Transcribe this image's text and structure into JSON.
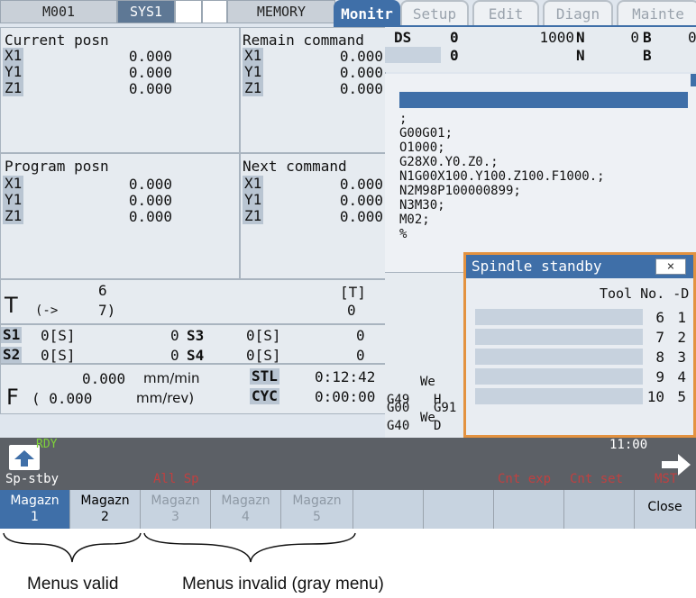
{
  "topbar": {
    "m001": "M001",
    "sys1": "SYS1",
    "memory": "MEMORY"
  },
  "tabs": [
    "Monitr",
    "Setup",
    "Edit",
    "Diagn",
    "Mainte"
  ],
  "current_posn": {
    "title": "Current posn",
    "rows": [
      {
        "axis": "X1",
        "val": "0.000"
      },
      {
        "axis": "Y1",
        "val": "0.000"
      },
      {
        "axis": "Z1",
        "val": "0.000"
      }
    ]
  },
  "remain_command": {
    "title": "Remain command",
    "rows": [
      {
        "axis": "X1",
        "val": "0.000"
      },
      {
        "axis": "Y1",
        "val": "0.000"
      },
      {
        "axis": "Z1",
        "val": "0.000"
      }
    ]
  },
  "program_posn": {
    "title": "Program posn",
    "rows": [
      {
        "axis": "X1",
        "val": "0.000"
      },
      {
        "axis": "Y1",
        "val": "0.000"
      },
      {
        "axis": "Z1",
        "val": "0.000"
      }
    ]
  },
  "next_command": {
    "title": "Next command",
    "rows": [
      {
        "axis": "X1",
        "val": "0.000"
      },
      {
        "axis": "Y1",
        "val": "0.000"
      },
      {
        "axis": "Z1",
        "val": "0.000"
      }
    ]
  },
  "ds": {
    "label": "DS",
    "v1": "0",
    "v2": "1000",
    "n1": "N",
    "n2": "0",
    "b": "B",
    "b0": "0",
    "v3": "0",
    "n3": "N",
    "b2": "B"
  },
  "program": [
    ";",
    "G00G01;",
    "O1000;",
    "G28X0.Y0.Z0.;",
    "N1G00X100.Y100.Z100.F1000.;",
    "N2M98P100000899;",
    "N3M30;",
    "M02;",
    "%"
  ],
  "tool": {
    "T": "T",
    "top": "6",
    "arrow": "(->",
    "next": "7)",
    "bracket": "[T]",
    "tval": "0"
  },
  "spindle": [
    {
      "s": "S1",
      "v": "0[S]",
      "x": "0",
      "s2": "S3",
      "v2": "0[S]",
      "x2": "0"
    },
    {
      "s": "S2",
      "v": "0[S]",
      "x": "0",
      "s2": "S4",
      "v2": "0[S]",
      "x2": "0"
    }
  ],
  "feed": {
    "F": "F",
    "v1": "0.000",
    "u1": "mm/min",
    "v2": "( 0.000",
    "u2": "mm/rev)",
    "stl": "STL",
    "stl_v": "0:12:42",
    "cyc": "CYC",
    "cyc_v": "0:00:00"
  },
  "gcodes": {
    "g00": "G00",
    "g91": "G91",
    "g40": "G40",
    "d": "D",
    "we1": "We",
    "g49": "G49",
    "h": "H",
    "we2": "We"
  },
  "popup": {
    "title": "Spindle standby",
    "close": "×",
    "header": "Tool No. -D",
    "rows": [
      {
        "tool": "6",
        "d": "1"
      },
      {
        "tool": "7",
        "d": "2"
      },
      {
        "tool": "8",
        "d": "3"
      },
      {
        "tool": "9",
        "d": "4"
      },
      {
        "tool": "10",
        "d": "5"
      }
    ]
  },
  "status": {
    "rdy": "RDY",
    "time": "11:00"
  },
  "softkeys": {
    "sp_stby": "Sp-stby",
    "all_sp": "All Sp",
    "cnt_exp": "Cnt exp",
    "cnt_set": "Cnt set",
    "mst": "MST"
  },
  "menus": [
    {
      "l1": "Magazn",
      "l2": "1"
    },
    {
      "l1": "Magazn",
      "l2": "2"
    },
    {
      "l1": "Magazn",
      "l2": "3"
    },
    {
      "l1": "Magazn",
      "l2": "4"
    },
    {
      "l1": "Magazn",
      "l2": "5"
    },
    {
      "l1": "",
      "l2": ""
    },
    {
      "l1": "",
      "l2": ""
    },
    {
      "l1": "",
      "l2": ""
    },
    {
      "l1": "",
      "l2": ""
    },
    {
      "l1": "Close",
      "l2": ""
    }
  ],
  "captions": {
    "valid": "Menus valid",
    "invalid": "Menus invalid (gray menu)"
  },
  "colors": {
    "accent": "#3f6fa8",
    "popup_border": "#e39240",
    "status_bar": "#5c6066",
    "rdy": "#7fd23a"
  }
}
